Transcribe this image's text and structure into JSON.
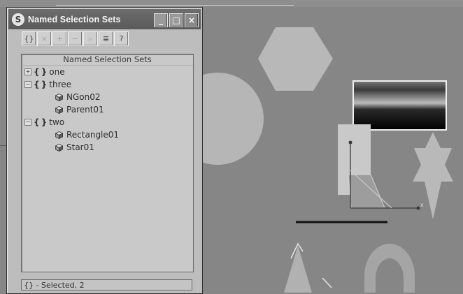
{
  "window": {
    "title": "Named Selection Sets",
    "logo_glyph": "S"
  },
  "title_buttons": {
    "minimize_glyph": "_",
    "maximize_glyph": "□",
    "close_glyph": "×"
  },
  "toolbar": {
    "tools": [
      {
        "name": "create-set-icon",
        "glyph": "{}",
        "enabled": true
      },
      {
        "name": "delete-icon",
        "glyph": "×",
        "enabled": false
      },
      {
        "name": "add-selected-icon",
        "glyph": "+",
        "enabled": false
      },
      {
        "name": "subtract-selected-icon",
        "glyph": "−",
        "enabled": false
      },
      {
        "name": "select-objects-in-set-icon",
        "glyph": "⌕",
        "enabled": false
      },
      {
        "name": "select-by-name-icon",
        "glyph": "≣",
        "enabled": true
      },
      {
        "name": "highlight-selected-icon",
        "glyph": "?",
        "enabled": true
      }
    ]
  },
  "list": {
    "header": "Named Selection Sets",
    "items": [
      {
        "type": "set",
        "label": "one",
        "expander": "+",
        "depth": 0
      },
      {
        "type": "set",
        "label": "three",
        "expander": "−",
        "depth": 0
      },
      {
        "type": "object",
        "label": "NGon02",
        "depth": 1
      },
      {
        "type": "object",
        "label": "Parent01",
        "depth": 1
      },
      {
        "type": "set",
        "label": "two",
        "expander": "−",
        "depth": 0
      },
      {
        "type": "object",
        "label": "Rectangle01",
        "depth": 1
      },
      {
        "type": "object",
        "label": "Star01",
        "depth": 1
      }
    ]
  },
  "status": {
    "text": "{} - Selected, 2"
  },
  "colors": {
    "viewport_bg": "#868686",
    "shape_fill": "#b7b7b7",
    "dialog_bg": "#bdbdbd",
    "titlebar": "#5f5f5f"
  }
}
